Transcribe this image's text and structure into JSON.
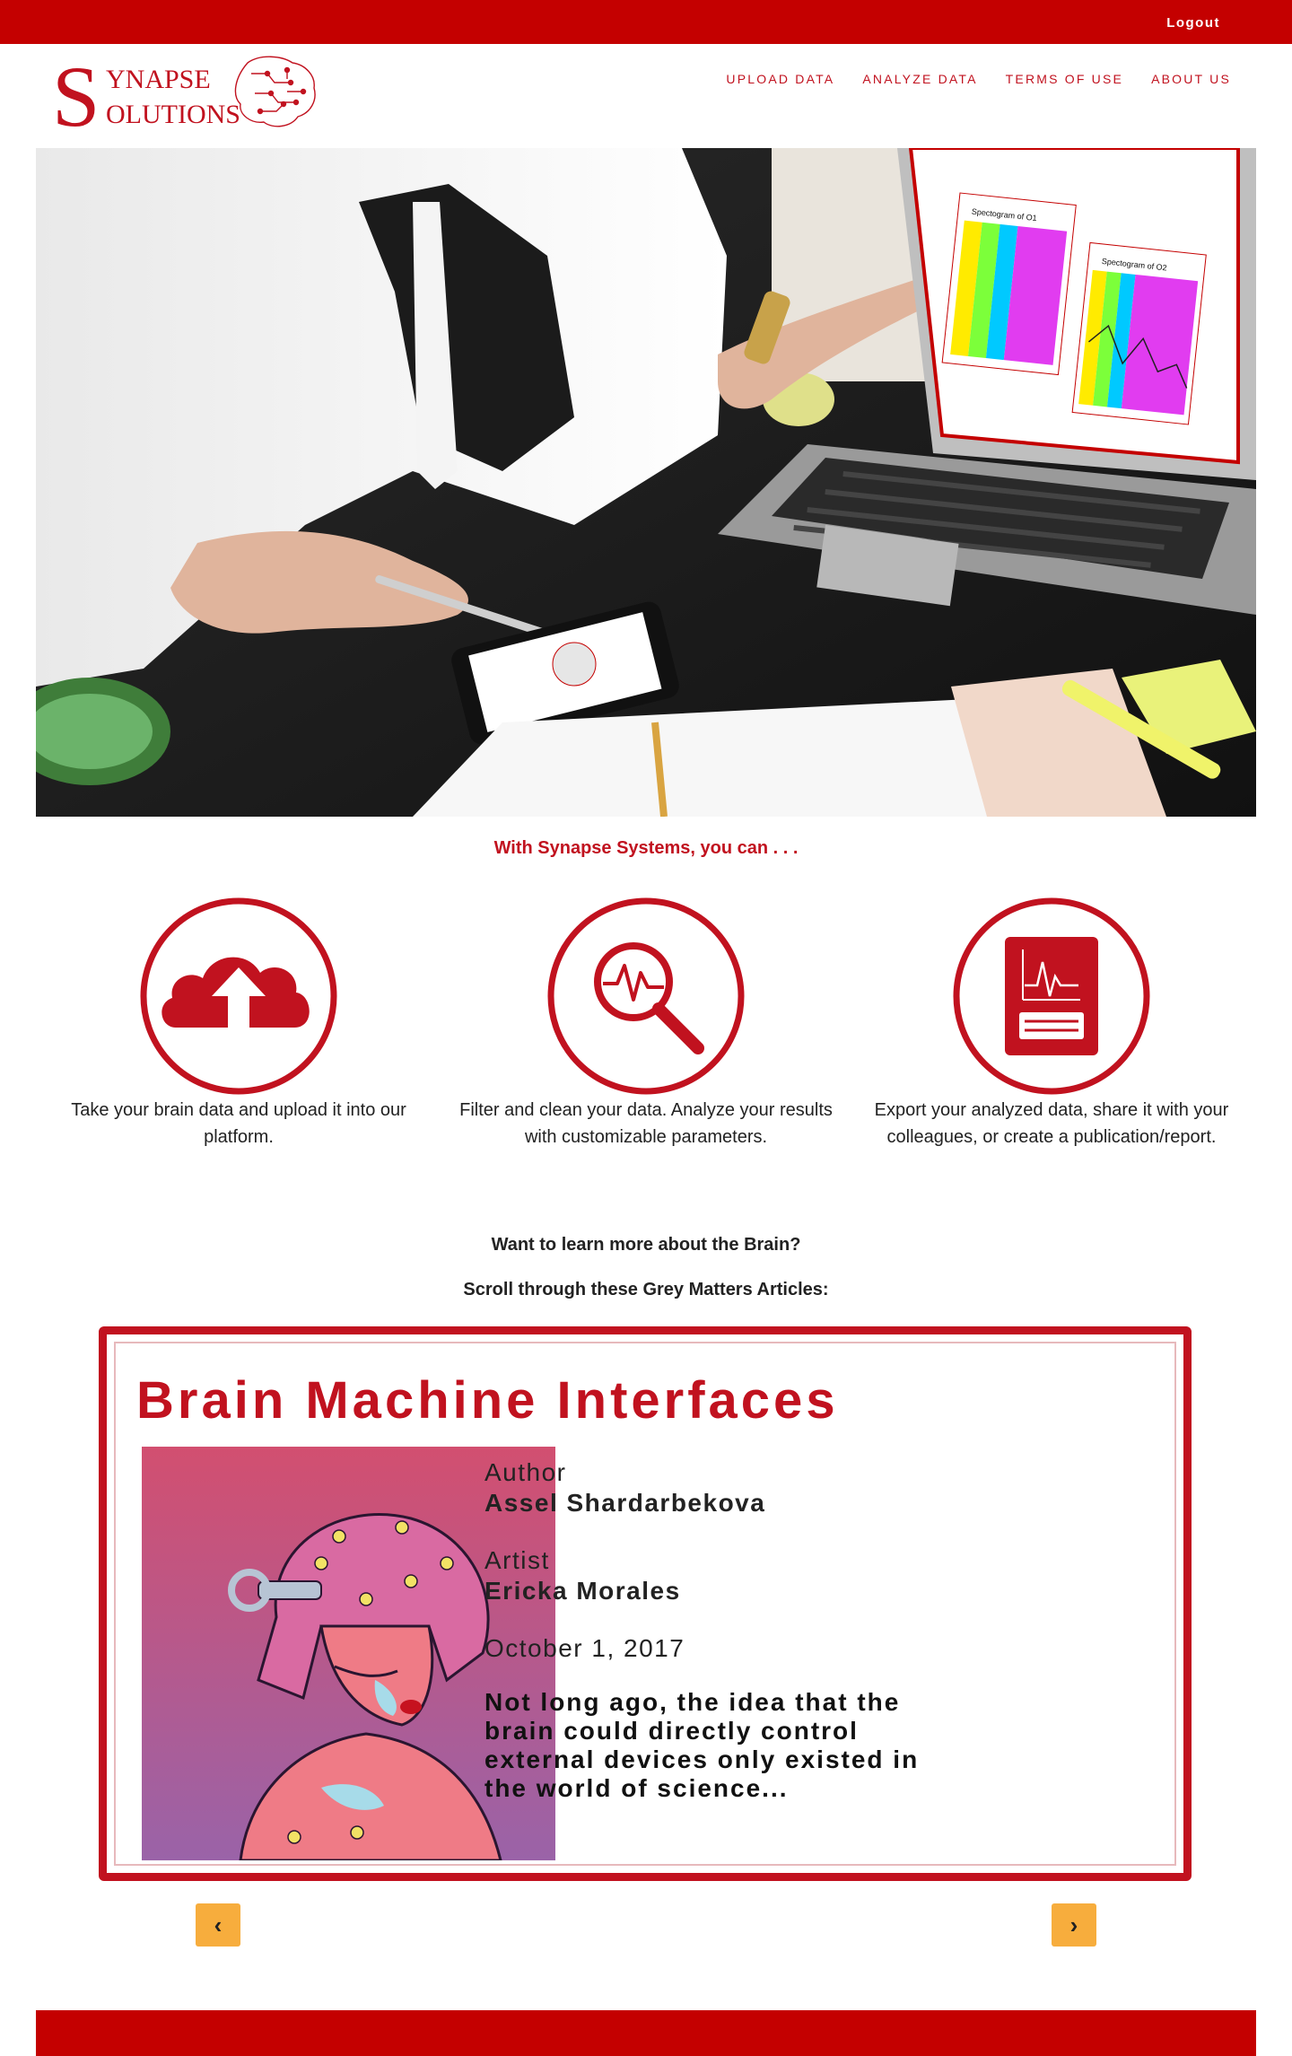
{
  "topbar": {
    "logout_label": "Logout"
  },
  "logo": {
    "line1_initial": "S",
    "line1": "YNAPSE",
    "line2": "OLUTIONS"
  },
  "nav": {
    "items": [
      "UPLOAD DATA",
      "ANALYZE DATA",
      "TERMS OF USE",
      "ABOUT US"
    ]
  },
  "hero": {
    "screen_panel_left": "Spectogram of O1",
    "screen_panel_right": "Spectogram of O2"
  },
  "tagline": "With Synapse Systems, you can . . .",
  "features": [
    {
      "icon": "cloud-upload-icon",
      "text": "Take your brain data and upload it into our platform."
    },
    {
      "icon": "magnify-pulse-icon",
      "text": "Filter and clean your data. Analyze your results with customizable parameters."
    },
    {
      "icon": "report-document-icon",
      "text": "Export your analyzed data, share it with your colleagues, or create a publication/report."
    }
  ],
  "learn": {
    "heading": "Want to learn more about the Brain?",
    "subheading": "Scroll through these Grey Matters Articles:"
  },
  "article": {
    "title": "Brain Machine Interfaces",
    "author_label": "Author",
    "author": "Assel Shardarbekova",
    "artist_label": "Artist",
    "artist": "Ericka Morales",
    "date": "October 1, 2017",
    "excerpt": "Not long ago, the idea that the brain could directly control external devices only existed in the world of science..."
  },
  "carousel": {
    "prev_label": "‹",
    "next_label": "›"
  },
  "colors": {
    "brand_red": "#c40000",
    "accent_red": "#c1121f",
    "button_orange": "#f7ad3d"
  }
}
